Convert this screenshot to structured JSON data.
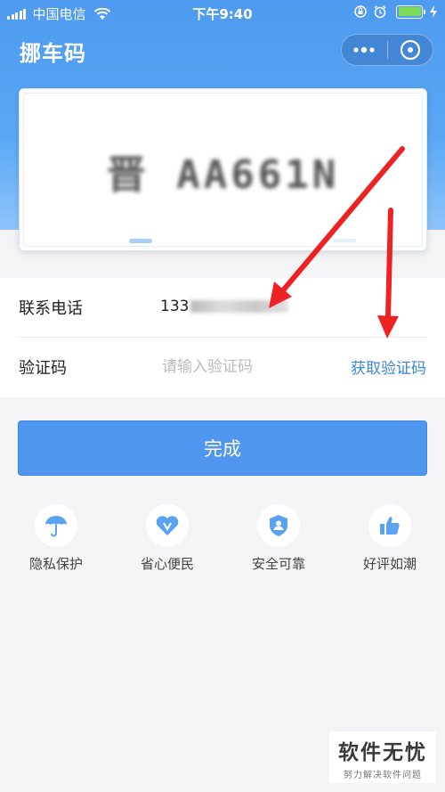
{
  "status_bar": {
    "carrier": "中国电信",
    "time": "下午9:40"
  },
  "header": {
    "title": "挪车码",
    "more_icon": "more-dots-icon",
    "close_icon": "close-circle-icon"
  },
  "plate": {
    "number": "晋 AA661N"
  },
  "form": {
    "phone_label": "联系电话",
    "phone_value": "133",
    "code_label": "验证码",
    "code_placeholder": "请输入验证码",
    "get_code_label": "获取验证码"
  },
  "done_button_label": "完成",
  "features": [
    {
      "label": "隐私保护",
      "icon": "umbrella-icon"
    },
    {
      "label": "省心便民",
      "icon": "heart-v-icon"
    },
    {
      "label": "安全可靠",
      "icon": "shield-user-icon"
    },
    {
      "label": "好评如潮",
      "icon": "thumbs-up-icon"
    }
  ],
  "watermark": {
    "title": "软件无忧",
    "subtitle": "努力解决软件问题"
  },
  "colors": {
    "accent": "#4f97ee",
    "link": "#3c86d8",
    "header_blue": "#4d9af0",
    "annotation_arrow": "#ee2222"
  }
}
